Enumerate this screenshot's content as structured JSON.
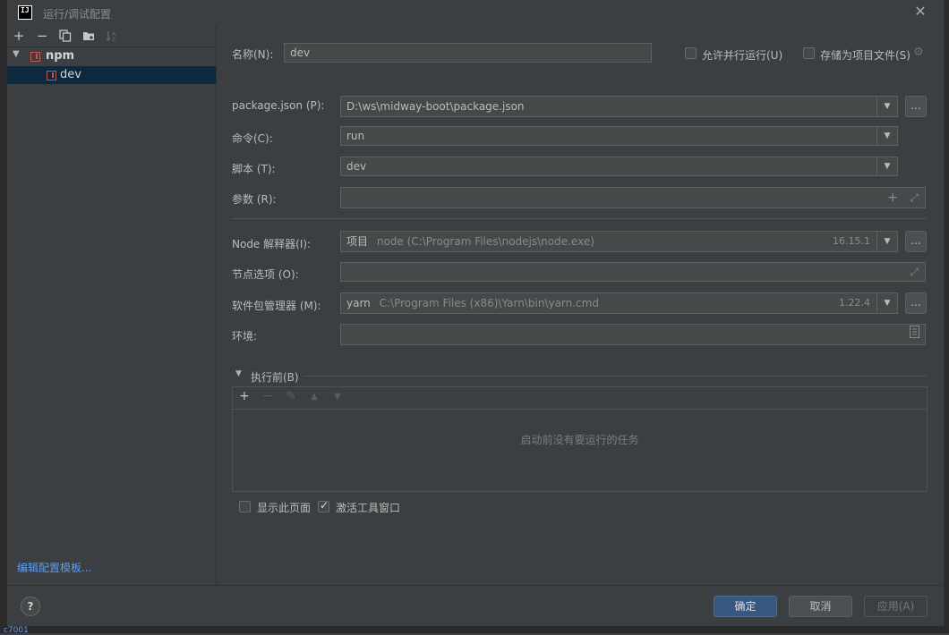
{
  "window": {
    "title": "运行/调试配置",
    "logo_text": "IJ"
  },
  "left": {
    "tree": {
      "group": "npm",
      "item": "dev"
    },
    "edit_templates_link": "编辑配置模板..."
  },
  "form": {
    "name_label": "名称(N):",
    "name_value": "dev",
    "allow_parallel_label": "允许并行运行(U)",
    "store_as_file_label": "存储为项目文件(S)",
    "package_json_label": "package.json (P):",
    "package_json_value": "D:\\ws\\midway-boot\\package.json",
    "command_label": "命令(C):",
    "command_value": "run",
    "script_label": "脚本 (T):",
    "script_value": "dev",
    "args_label": "参数 (R):",
    "args_value": "",
    "node_interp_label": "Node 解释器(I):",
    "node_interp_prefix": "项目",
    "node_interp_path": "node (C:\\Program Files\\nodejs\\node.exe)",
    "node_interp_version": "16.15.1",
    "node_opts_label": "节点选项 (O):",
    "node_opts_value": "",
    "pkg_manager_label": "软件包管理器 (M):",
    "pkg_manager_name": "yarn",
    "pkg_manager_path": "C:\\Program Files (x86)\\Yarn\\bin\\yarn.cmd",
    "pkg_manager_version": "1.22.4",
    "env_label": "环境:",
    "env_value": "",
    "dots": "..."
  },
  "before_launch": {
    "title": "执行前(B)",
    "empty_text": "启动前没有要运行的任务"
  },
  "options": {
    "show_page_label": "显示此页面",
    "activate_tool_window_label": "激活工具窗口"
  },
  "footer": {
    "help": "?",
    "ok": "确定",
    "cancel": "取消",
    "apply": "应用(A)"
  },
  "background": {
    "bottom_text": "c7001"
  }
}
